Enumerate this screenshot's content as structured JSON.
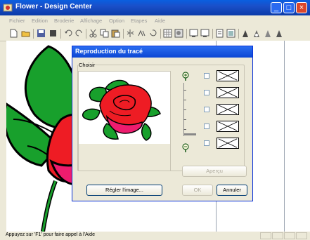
{
  "window": {
    "title": "Flower - Design Center"
  },
  "menu": [
    "Fichier",
    "Edition",
    "Broderie",
    "Affichage",
    "Option",
    "Etapes",
    "Aide"
  ],
  "toolbar_icons": [
    "new-icon",
    "open-icon",
    "save-icon",
    "stop-icon",
    "undo-icon",
    "redo-icon",
    "cut-icon",
    "copy-icon",
    "paste-icon",
    "flip-icon",
    "mirror-icon",
    "rotate-icon",
    "grid-icon",
    "pattern-icon",
    "zoom-in-icon",
    "zoom-out-icon",
    "transfer-icon",
    "fit-icon",
    "hand-icon",
    "thread-icon",
    "stitch-icon",
    "stitch2-icon"
  ],
  "dialog": {
    "title": "Reproduction du tracé",
    "group_label": "Choisir",
    "apercu": "Aperçu",
    "regler": "Régler l'image...",
    "ok": "OK",
    "annuler": "Annuler"
  },
  "status": {
    "text": "Appuyez sur 'F1' pour faire appel à l'Aide"
  }
}
